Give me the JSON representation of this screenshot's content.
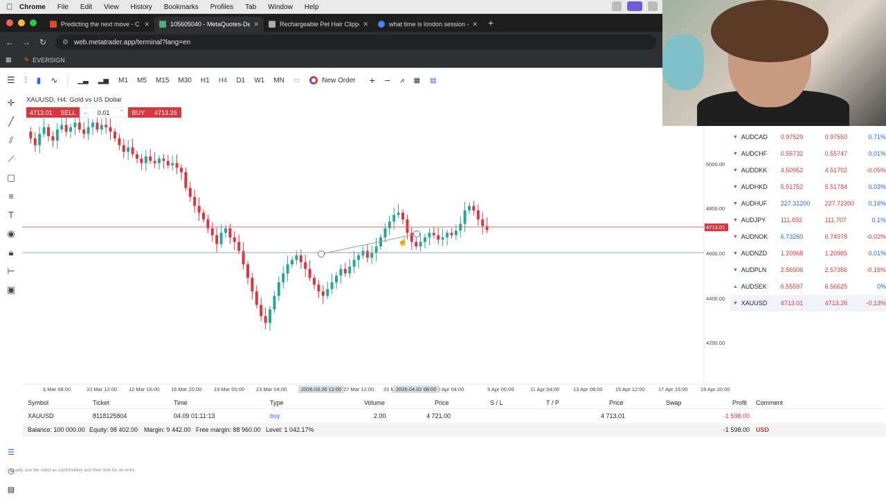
{
  "menubar": {
    "items": [
      "Chrome",
      "File",
      "Edit",
      "View",
      "History",
      "Bookmarks",
      "Profiles",
      "Tab",
      "Window",
      "Help"
    ]
  },
  "tabs": [
    {
      "title": "Predicting the next move - C",
      "color": "#e04a2c"
    },
    {
      "title": "105605040 - MetaQuotes-De",
      "color": "#4caf78"
    },
    {
      "title": "Rechargeable Pet Hair Clippe",
      "color": "#aaaaaa"
    },
    {
      "title": "what time is london session -",
      "color": "#4285f4"
    }
  ],
  "address": {
    "url": "web.metatrader.app/terminal?lang=en"
  },
  "bookmarks": {
    "item": "EVERSIGN"
  },
  "toolbar": {
    "timeframes": [
      "M1",
      "M5",
      "M15",
      "M30",
      "H1",
      "H4",
      "D1",
      "W1",
      "MN"
    ],
    "selected_timeframe": "H4",
    "new_order": "New Order"
  },
  "symbol": {
    "header": "XAUUSD, H4: Gold vs US Dollar"
  },
  "trade": {
    "sell_price": "4713.01",
    "sell_label": "SELL",
    "lot": "0.01",
    "buy_label": "BUY",
    "buy_price": "4713.26"
  },
  "chart_data": {
    "type": "candlestick",
    "y_ticks": [
      "5000.00",
      "4800.00",
      "4600.00",
      "4400.00",
      "4200.00"
    ],
    "x_ticks": [
      "6 Mar 08:00",
      "10 Mar 12:00",
      "12 Mar 16:00",
      "16 Mar 20:00",
      "19 Mar 00:00",
      "23 Mar 04:00",
      "27 Mar 12:00",
      "31 Mar",
      "2 Apr 04:00",
      "9 Apr 00:00",
      "11 Apr 04:00",
      "13 Apr 08:00",
      "15 Apr 12:00",
      "17 Apr 16:00",
      "19 Apr 20:00"
    ],
    "x_marker_labels": [
      "2026.03.26 12:00",
      "2026.04.02 08:00"
    ],
    "current_price_label": "4713.01",
    "up_color": "#26a69a",
    "down_color": "#d9363e"
  },
  "watchlist": [
    {
      "symbol": "AUDCAD",
      "dir": "down",
      "bid": "0.97529",
      "ask": "0.97550",
      "change": "0.71%"
    },
    {
      "symbol": "AUDCHF",
      "dir": "down",
      "bid": "0.55732",
      "ask": "0.55747",
      "change": "0.01%"
    },
    {
      "symbol": "AUDDKK",
      "dir": "down",
      "bid": "4.50952",
      "ask": "4.51702",
      "change": "-0.05%"
    },
    {
      "symbol": "AUDHKD",
      "dir": "down",
      "bid": "5.51752",
      "ask": "5.51784",
      "change": "0.03%"
    },
    {
      "symbol": "AUDHUF",
      "dir": "down",
      "bid": "227.31200",
      "ask": "227.72300",
      "change": "0.16%"
    },
    {
      "symbol": "AUDJPY",
      "dir": "down",
      "bid": "111.692",
      "ask": "111.707",
      "change": "0.1%"
    },
    {
      "symbol": "AUDNOK",
      "dir": "down",
      "bid": "6.73260",
      "ask": "6.74978",
      "change": "-0.02%"
    },
    {
      "symbol": "AUDNZD",
      "dir": "down",
      "bid": "1.20968",
      "ask": "1.20985",
      "change": "0.01%"
    },
    {
      "symbol": "AUDPLN",
      "dir": "down",
      "bid": "2.56506",
      "ask": "2.57356",
      "change": "-0.16%"
    },
    {
      "symbol": "AUDSEK",
      "dir": "up",
      "bid": "6.55597",
      "ask": "6.56625",
      "change": "0%"
    },
    {
      "symbol": "XAUUSD",
      "dir": "down",
      "bid": "4713.01",
      "ask": "4713.26",
      "change": "-0.13%"
    }
  ],
  "positions": {
    "headers": [
      "Symbol",
      "Ticket",
      "Time",
      "Type",
      "Volume",
      "Price",
      "S / L",
      "T / P",
      "Price",
      "Swap",
      "Profit",
      "Comment"
    ],
    "row": {
      "symbol": "XAUUSD",
      "ticket": "8118125804",
      "time": "04.09 01:11:13",
      "type": "buy",
      "volume": "2.00",
      "price": "4 721.00",
      "current": "4 713.01",
      "profit": "-1 598.00"
    },
    "balance": {
      "balance": "Balance: 100 000.00",
      "equity": "Equity: 98 402.00",
      "margin": "Margin: 9 442.00",
      "free": "Free margin: 88 960.00",
      "level": "Level: 1 042.17%",
      "profit": "-1 598.00",
      "currency": "USD"
    }
  },
  "caption": "...usually use the robot as confirmation and then look for an entry"
}
